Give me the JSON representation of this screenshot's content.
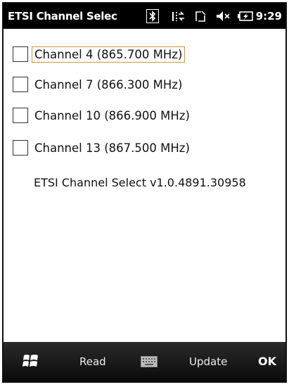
{
  "titlebar": {
    "title": "ETSI Channel Selec",
    "time": "9:29",
    "icons": [
      "bluetooth-icon",
      "network-sync-icon",
      "signal-off-icon",
      "volume-muted-icon",
      "battery-charging-icon"
    ]
  },
  "channels": [
    {
      "label": "Channel 4 (865.700 MHz)",
      "checked": false,
      "focused": true
    },
    {
      "label": "Channel 7 (866.300 MHz)",
      "checked": false,
      "focused": false
    },
    {
      "label": "Channel 10 (866.900 MHz)",
      "checked": false,
      "focused": false
    },
    {
      "label": "Channel 13 (867.500 MHz)",
      "checked": false,
      "focused": false
    }
  ],
  "version_text": "ETSI Channel Select v1.0.4891.30958",
  "softkeys": {
    "left": "Read",
    "right": "Update",
    "ok": "OK",
    "icons": [
      "windows-start-icon",
      "keyboard-icon"
    ]
  },
  "colors": {
    "titlebar_bg": "#000000",
    "focus_border": "#c89a3a",
    "softbar_bg": "#1a1a1a"
  }
}
